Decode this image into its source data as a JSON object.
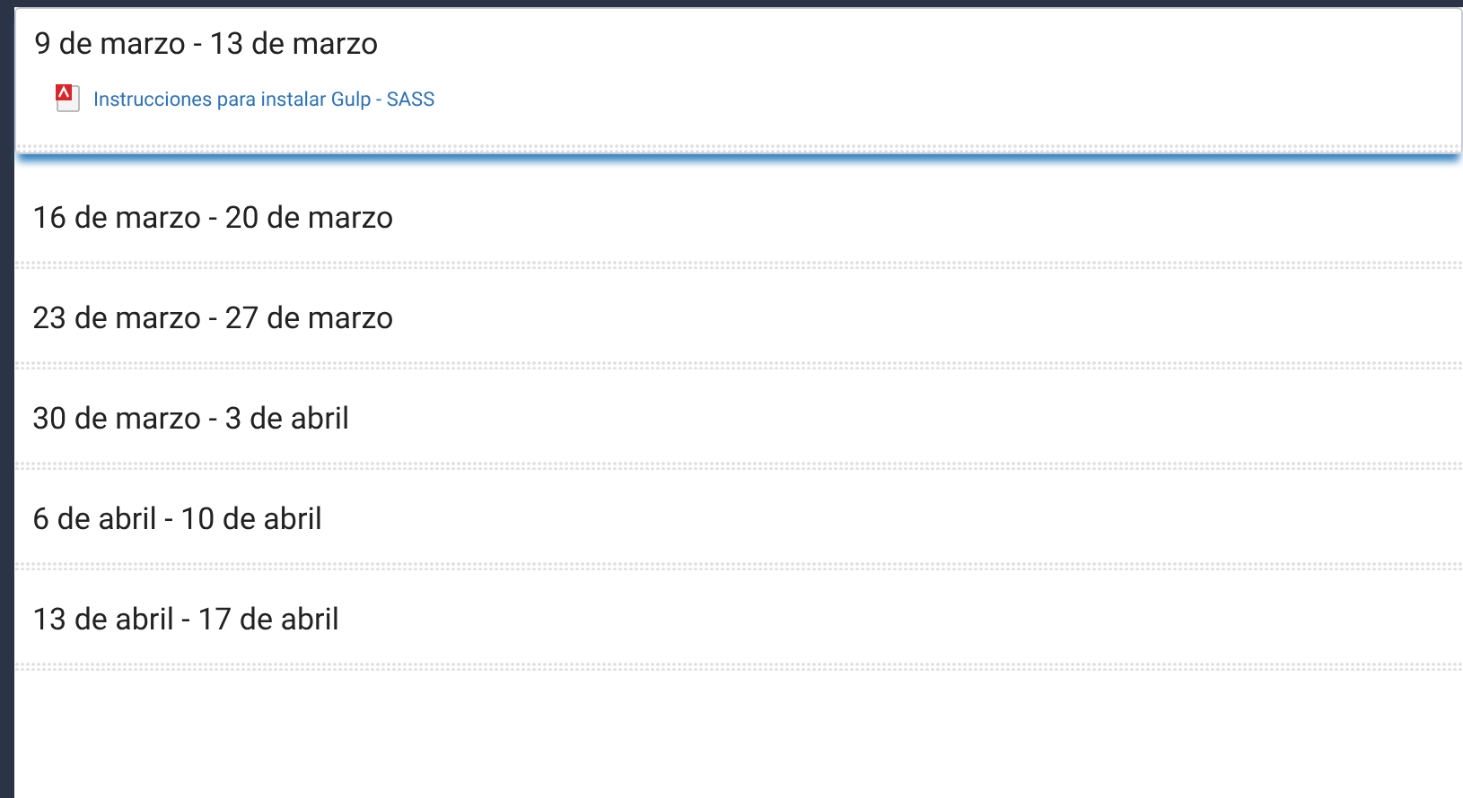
{
  "sections": [
    {
      "title": "9 de marzo - 13 de marzo",
      "current": true,
      "resources": [
        {
          "kind": "pdf",
          "label": "Instrucciones para instalar Gulp - SASS"
        }
      ]
    },
    {
      "title": "16 de marzo - 20 de marzo",
      "current": false
    },
    {
      "title": "23 de marzo - 27 de marzo",
      "current": false
    },
    {
      "title": "30 de marzo - 3 de abril",
      "current": false
    },
    {
      "title": "6 de abril - 10 de abril",
      "current": false
    },
    {
      "title": "13 de abril - 17 de abril",
      "current": false
    }
  ]
}
